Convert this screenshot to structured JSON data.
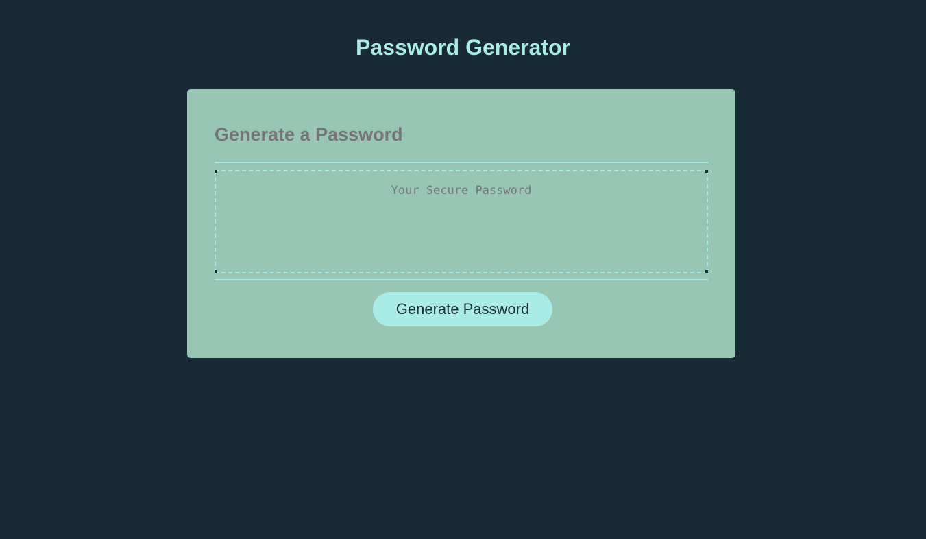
{
  "header": {
    "title": "Password Generator"
  },
  "card": {
    "heading": "Generate a Password",
    "password_placeholder": "Your Secure Password",
    "password_value": "",
    "generate_button_label": "Generate Password"
  },
  "colors": {
    "background": "#182a36",
    "card": "#99c5b4",
    "accent": "#a9ebe6",
    "heading_text": "#757575"
  }
}
